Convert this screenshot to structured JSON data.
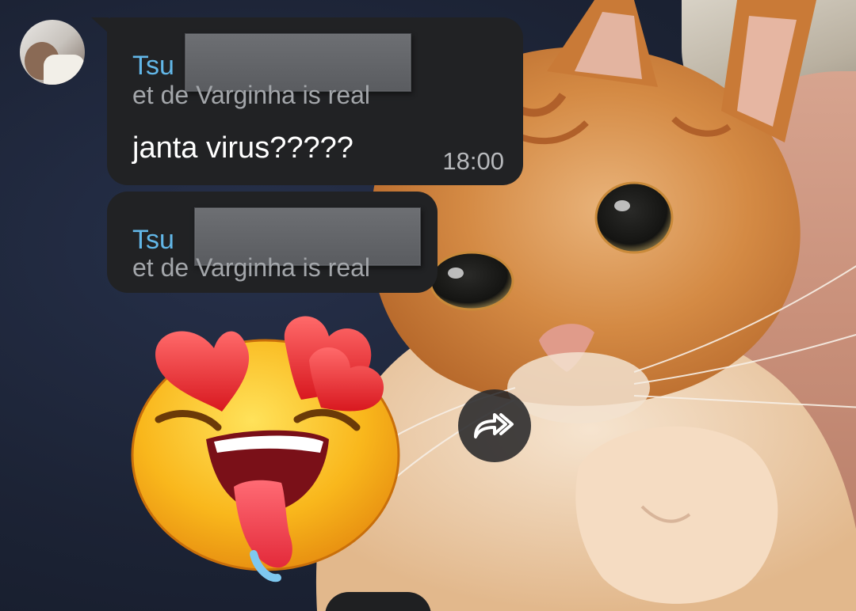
{
  "messages": [
    {
      "sender": "Tsu",
      "reply_snippet": "et de Varginha is real",
      "text": "janta virus?????",
      "time": "18:00"
    },
    {
      "sender": "Tsu",
      "reply_snippet": "et de Varginha is real"
    }
  ],
  "sticker": {
    "name": "in-love-emoji-sticker"
  },
  "forward": {
    "icon": "forward-double-arrow-icon"
  },
  "colors": {
    "bubble": "#212224",
    "sender_name": "#62b7e8",
    "reply_snippet": "#a3a6aa",
    "timestamp": "#b7b9bc"
  }
}
